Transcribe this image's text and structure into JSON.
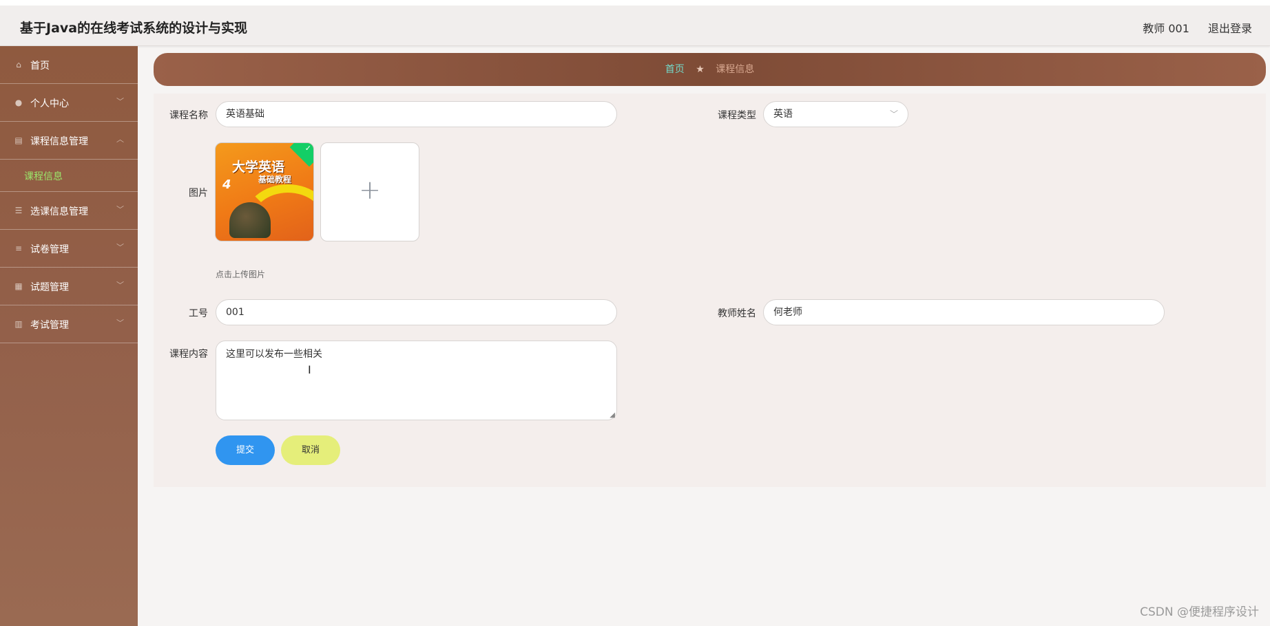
{
  "app": {
    "title": "基于Java的在线考试系统的设计与实现"
  },
  "header": {
    "user": "教师 001",
    "logout": "退出登录"
  },
  "sidebar": {
    "items": [
      {
        "label": "首页",
        "icon": "home-icon"
      },
      {
        "label": "个人中心",
        "icon": "user-icon"
      },
      {
        "label": "课程信息管理",
        "icon": "clipboard-icon",
        "expanded": true
      },
      {
        "label": "选课信息管理",
        "icon": "list-icon"
      },
      {
        "label": "试卷管理",
        "icon": "sliders-icon"
      },
      {
        "label": "试题管理",
        "icon": "grid-icon"
      },
      {
        "label": "考试管理",
        "icon": "bar-chart-icon"
      }
    ],
    "submenu": {
      "label": "课程信息",
      "active_color": "#9be86b"
    }
  },
  "breadcrumb": {
    "home": "首页",
    "separator": "★",
    "current": "课程信息"
  },
  "form": {
    "course_name_label": "课程名称",
    "course_name_value": "英语基础",
    "course_type_label": "课程类型",
    "course_type_value": "英语",
    "image_label": "图片",
    "upload_hint": "点击上传图片",
    "cover_title": "大学英语",
    "cover_subtitle": "基础教程",
    "cover_number": "4",
    "teacher_id_label": "工号",
    "teacher_id_value": "001",
    "teacher_name_label": "教师姓名",
    "teacher_name_value": "何老师",
    "content_label": "课程内容",
    "content_value": "这里可以发布一些相关",
    "submit_label": "提交",
    "cancel_label": "取消"
  },
  "watermark": "CSDN @便捷程序设计",
  "colors": {
    "sidebar": "#93604a",
    "accent_blue": "#3095f0",
    "cancel_yellow": "#e5ee7a"
  }
}
